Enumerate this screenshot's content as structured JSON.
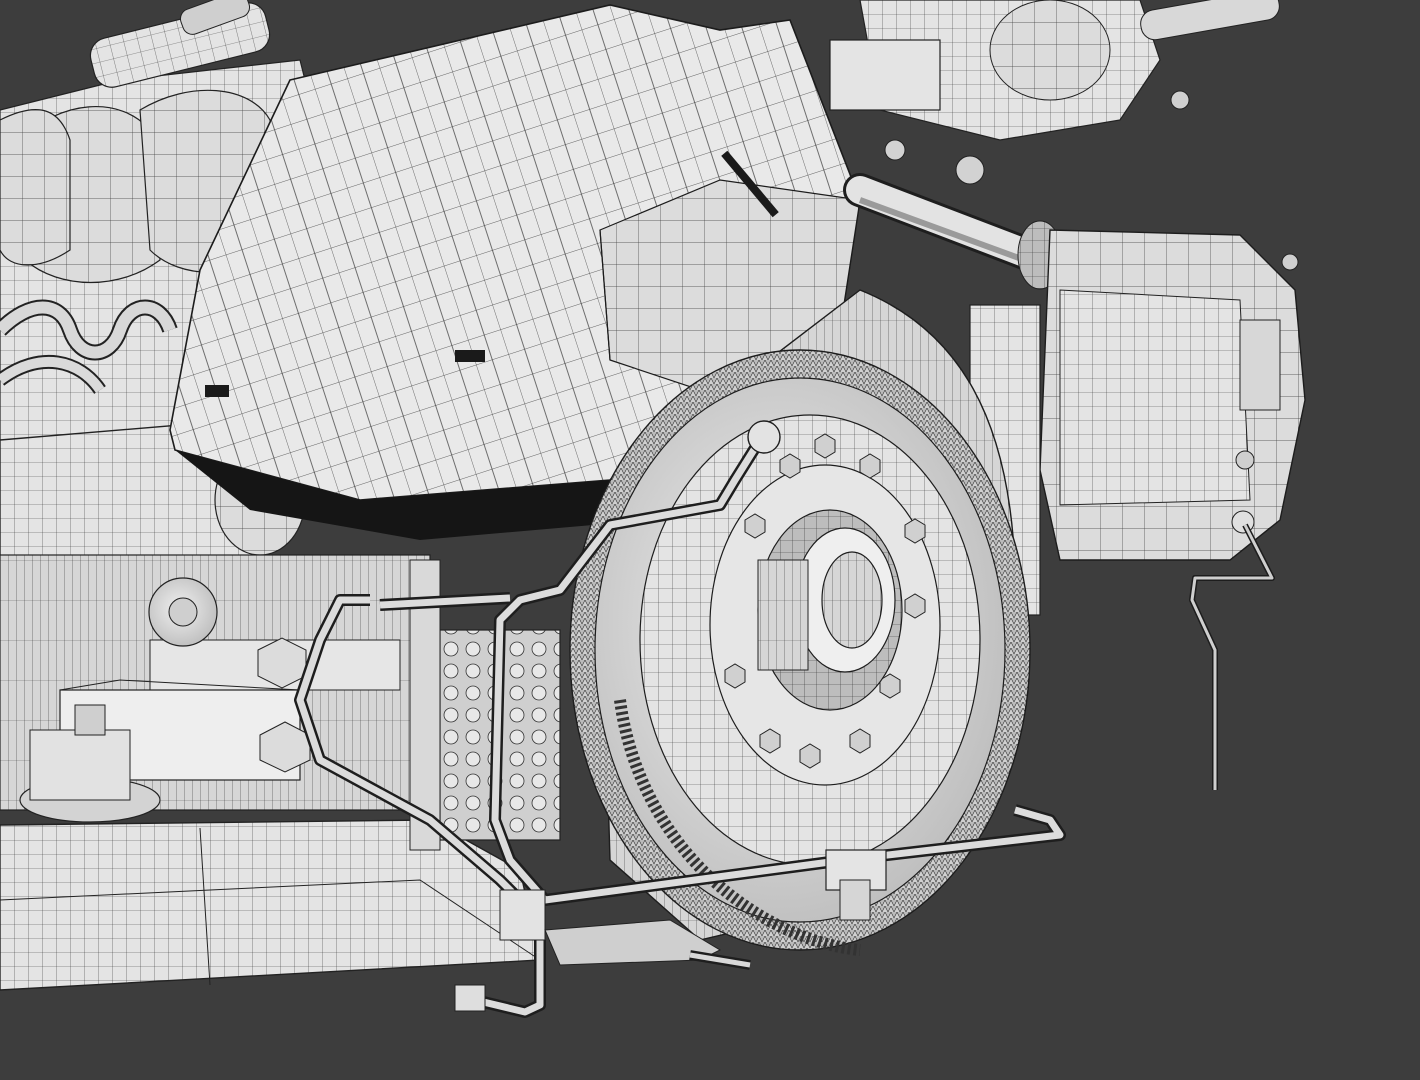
{
  "viewport": {
    "background_color": "#3d3d3d",
    "render_mode": "wireframe-on-shaded",
    "subject": "engine-model"
  },
  "colors": {
    "surface_light": "#e6e6e6",
    "surface_mid": "#c9c9c9",
    "surface_dark": "#8a8a8a",
    "shadow": "#1e1e1e",
    "wire": "#2a2a2a"
  }
}
